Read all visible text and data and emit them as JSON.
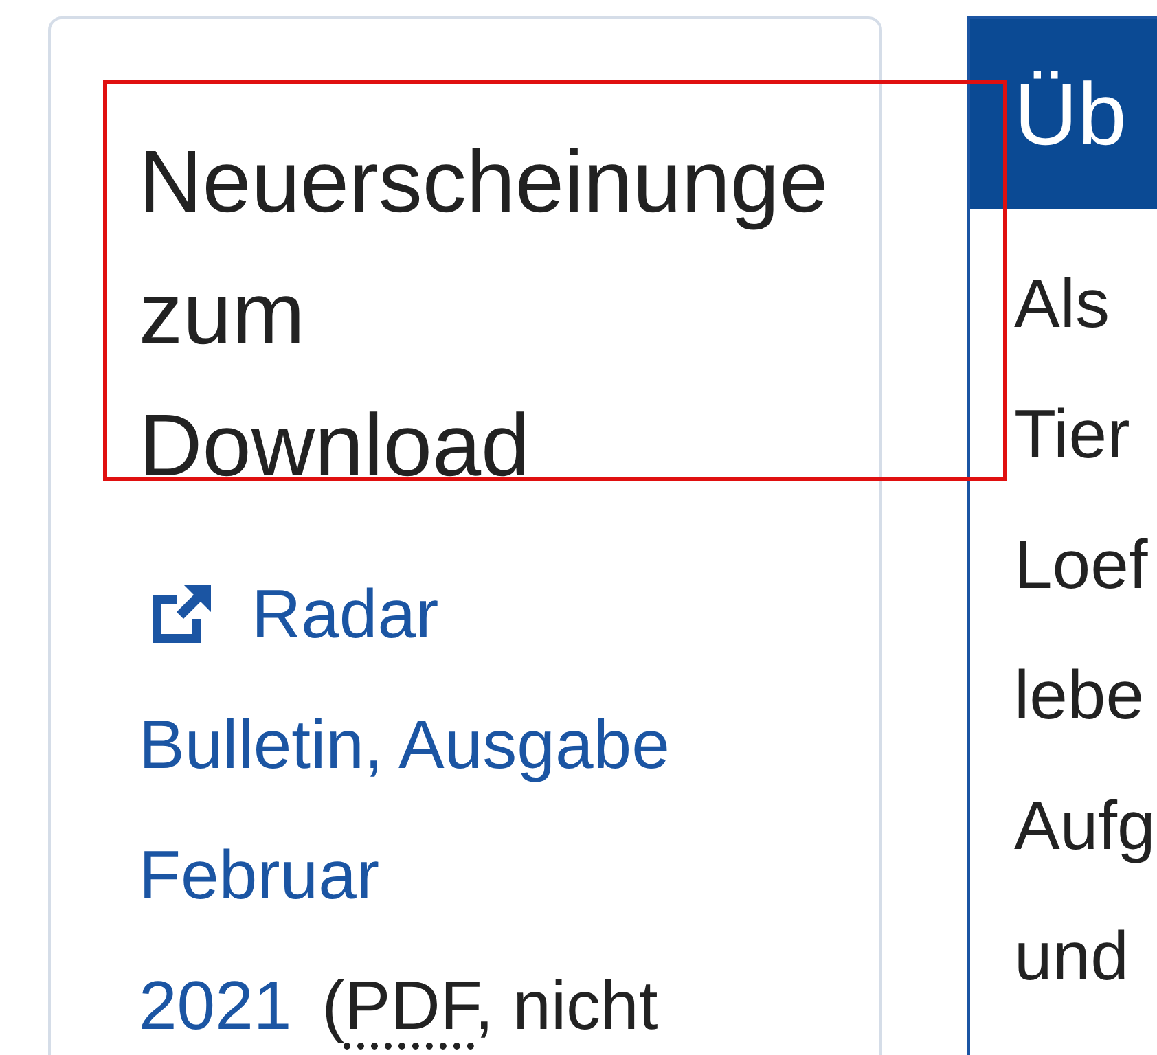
{
  "downloads_card": {
    "heading_lines": [
      "Neuerscheinunge",
      "zum",
      "Download"
    ],
    "link_lines": [
      "Radar",
      "Bulletin, Ausgabe",
      "Februar",
      "2021"
    ],
    "file_info": {
      "before": "(",
      "abbr": "PDF",
      "after": ", nicht"
    }
  },
  "about_panel": {
    "title": "Üb",
    "body_lines": [
      "Als",
      "Tier",
      "Loef",
      "lebe",
      "Aufg",
      "und"
    ]
  },
  "highlight": {
    "shown": true
  }
}
